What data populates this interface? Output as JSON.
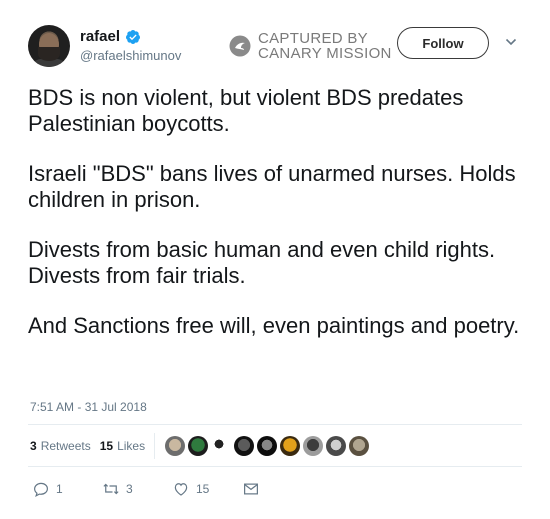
{
  "user": {
    "display_name": "rafael",
    "handle": "@rafaelshimunov",
    "verified": true
  },
  "watermark": {
    "line1": "CAPTURED BY",
    "line2": "CANARY MISSION"
  },
  "follow_label": "Follow",
  "tweet": {
    "paragraphs": [
      "BDS is non violent, but violent BDS predates Palestinian boycotts.",
      "Israeli \"BDS\" bans lives of unarmed nurses. Holds children in prison.",
      "Divests from basic human and even child rights. Divests from fair trials.",
      "And Sanctions free will, even paintings and poetry."
    ],
    "timestamp": "7:51 AM - 31 Jul 2018"
  },
  "stats": {
    "retweets_count": "3",
    "retweets_label": "Retweets",
    "likes_count": "15",
    "likes_label": "Likes"
  },
  "actions": {
    "replies": "1",
    "retweets": "3",
    "likes": "15"
  },
  "colors": {
    "verified_blue": "#1da1f2",
    "secondary_text": "#657786",
    "primary_text": "#14171a"
  },
  "icons": [
    "verified-badge-icon",
    "canary-mission-logo-icon",
    "chevron-down-icon",
    "reply-icon",
    "retweet-icon",
    "heart-icon",
    "direct-message-icon"
  ]
}
